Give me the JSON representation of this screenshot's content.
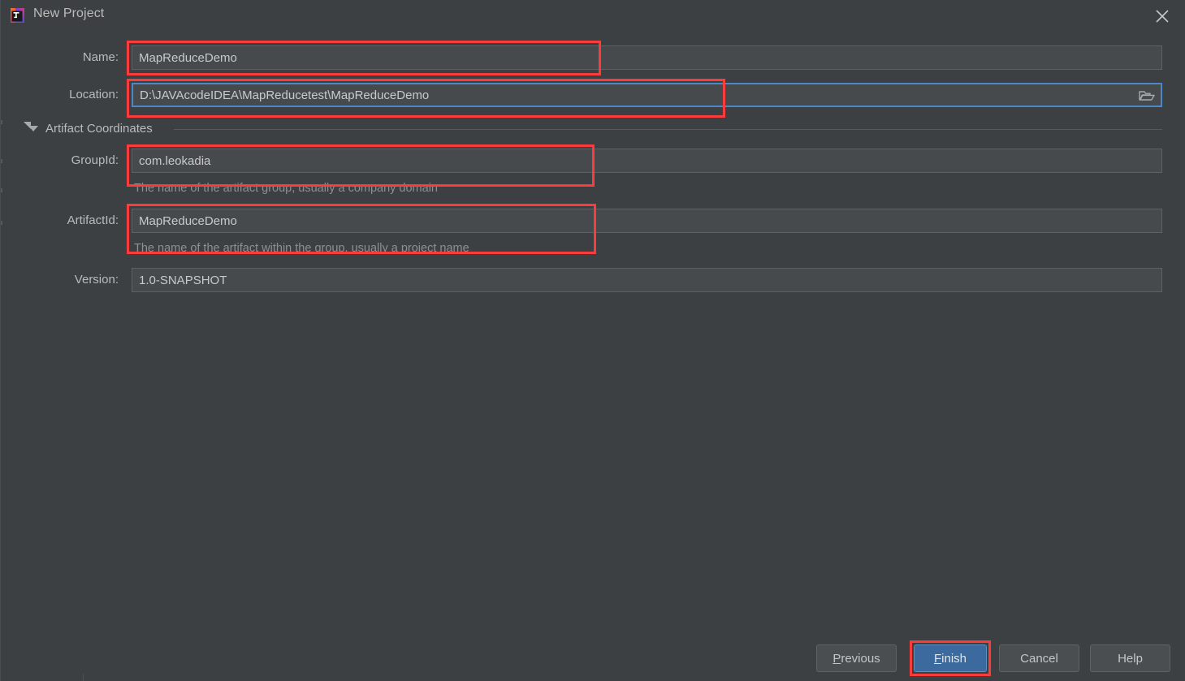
{
  "window": {
    "title": "New Project",
    "app_icon": "intellij-idea-icon",
    "close_icon": "close-icon",
    "background_color": "#3c4042"
  },
  "form": {
    "fields": [
      {
        "id": "name",
        "label": "Name:",
        "value": "MapReduceDemo",
        "placeholder": "",
        "focused": false,
        "hint": "",
        "highlighted": true
      },
      {
        "id": "location",
        "label": "Location:",
        "value": "D:\\JAVAcodeIDEA\\MapReducetest\\MapReduceDemo",
        "placeholder": "",
        "focused": true,
        "hint": "",
        "highlighted": true,
        "browse_icon": "folder-icon"
      },
      {
        "id": "groupid",
        "label": "GroupId:",
        "value": "com.leokadia",
        "placeholder": "",
        "focused": false,
        "hint": "The name of the artifact group, usually a company domain",
        "highlighted": true
      },
      {
        "id": "artifactid",
        "label": "ArtifactId:",
        "value": "MapReduceDemo",
        "placeholder": "",
        "focused": false,
        "hint": "The name of the artifact within the group, usually a project name",
        "highlighted": true
      },
      {
        "id": "version",
        "label": "Version:",
        "value": "1.0-SNAPSHOT",
        "placeholder": "",
        "focused": false,
        "hint": "",
        "highlighted": false
      }
    ],
    "section": {
      "title": "Artifact Coordinates",
      "expanded": true,
      "expand_icon": "chevron-down-icon"
    }
  },
  "footer": {
    "buttons": [
      {
        "id": "previous",
        "label": "Previous",
        "mnemonic": "P",
        "default": false,
        "highlighted": false
      },
      {
        "id": "finish",
        "label": "Finish",
        "mnemonic": "F",
        "default": true,
        "highlighted": true
      },
      {
        "id": "cancel",
        "label": "Cancel",
        "mnemonic": "",
        "default": false,
        "highlighted": false
      },
      {
        "id": "help",
        "label": "Help",
        "mnemonic": "",
        "default": false,
        "highlighted": false
      }
    ]
  },
  "annotations": {
    "color": "#fa3c3c",
    "stroke_width": 3,
    "count": 5
  },
  "colors": {
    "accent_blue": "#3c6a9e",
    "focus_blue": "#4a88c7",
    "annotation_red": "#fa3c3c",
    "field_bg": "#474a4c",
    "dialog_bg": "#3c4042",
    "text": "#c7cacb",
    "label_text": "#b9bcbd",
    "hint_text": "#8c9092"
  }
}
